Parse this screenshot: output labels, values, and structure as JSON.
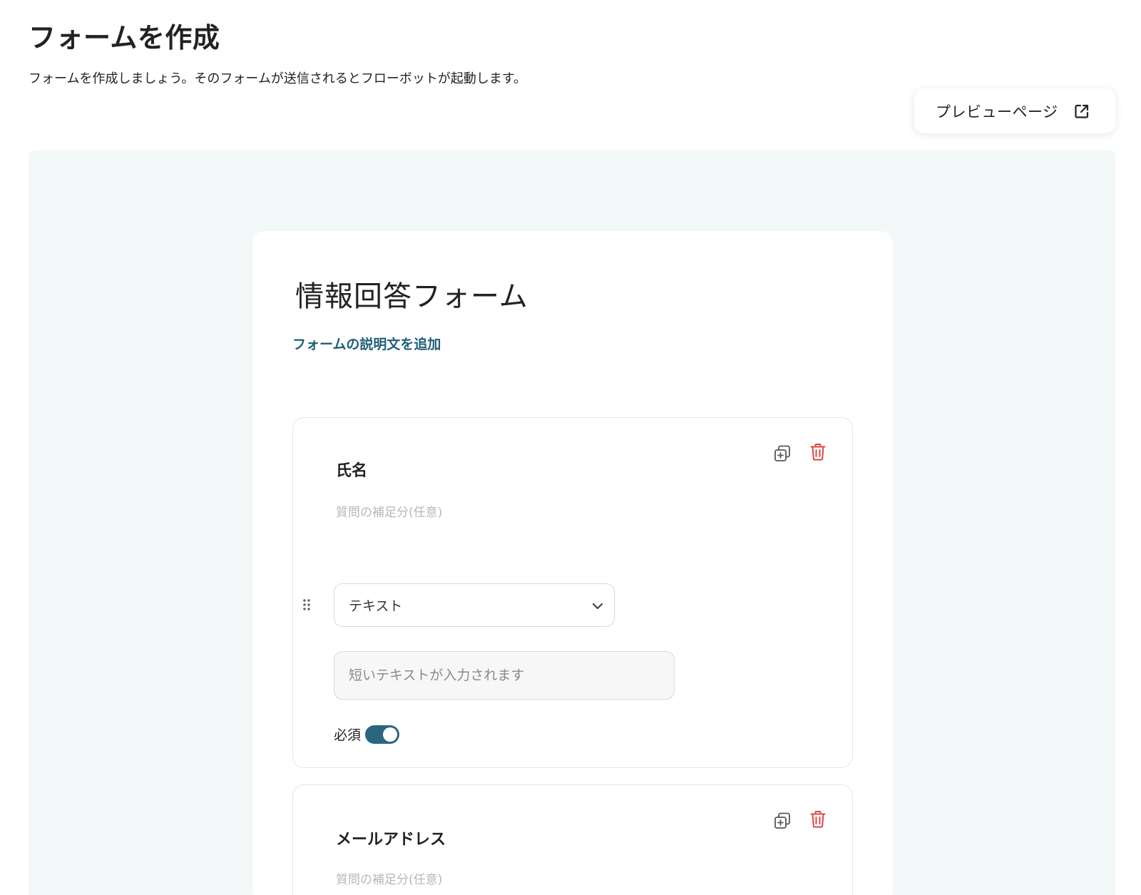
{
  "header": {
    "title": "フォームを作成",
    "description": "フォームを作成しましょう。そのフォームが送信されるとフローボットが起動します。"
  },
  "preview_button": {
    "label": "プレビューページ",
    "icon": "external-link-icon"
  },
  "form": {
    "title": "情報回答フォーム",
    "add_description_link": "フォームの説明文を追加",
    "questions": [
      {
        "title": "氏名",
        "subtitle_placeholder": "質問の補足分(任意)",
        "type_selected": "テキスト",
        "answer_placeholder": "短いテキストが入力されます",
        "required_label": "必須",
        "required": true
      },
      {
        "title": "メールアドレス",
        "subtitle_placeholder": "質問の補足分(任意)"
      }
    ]
  },
  "colors": {
    "accent": "#2a6680",
    "link": "#1f5f78",
    "delete": "#e04545",
    "canvas_bg": "#f2f7f7"
  }
}
